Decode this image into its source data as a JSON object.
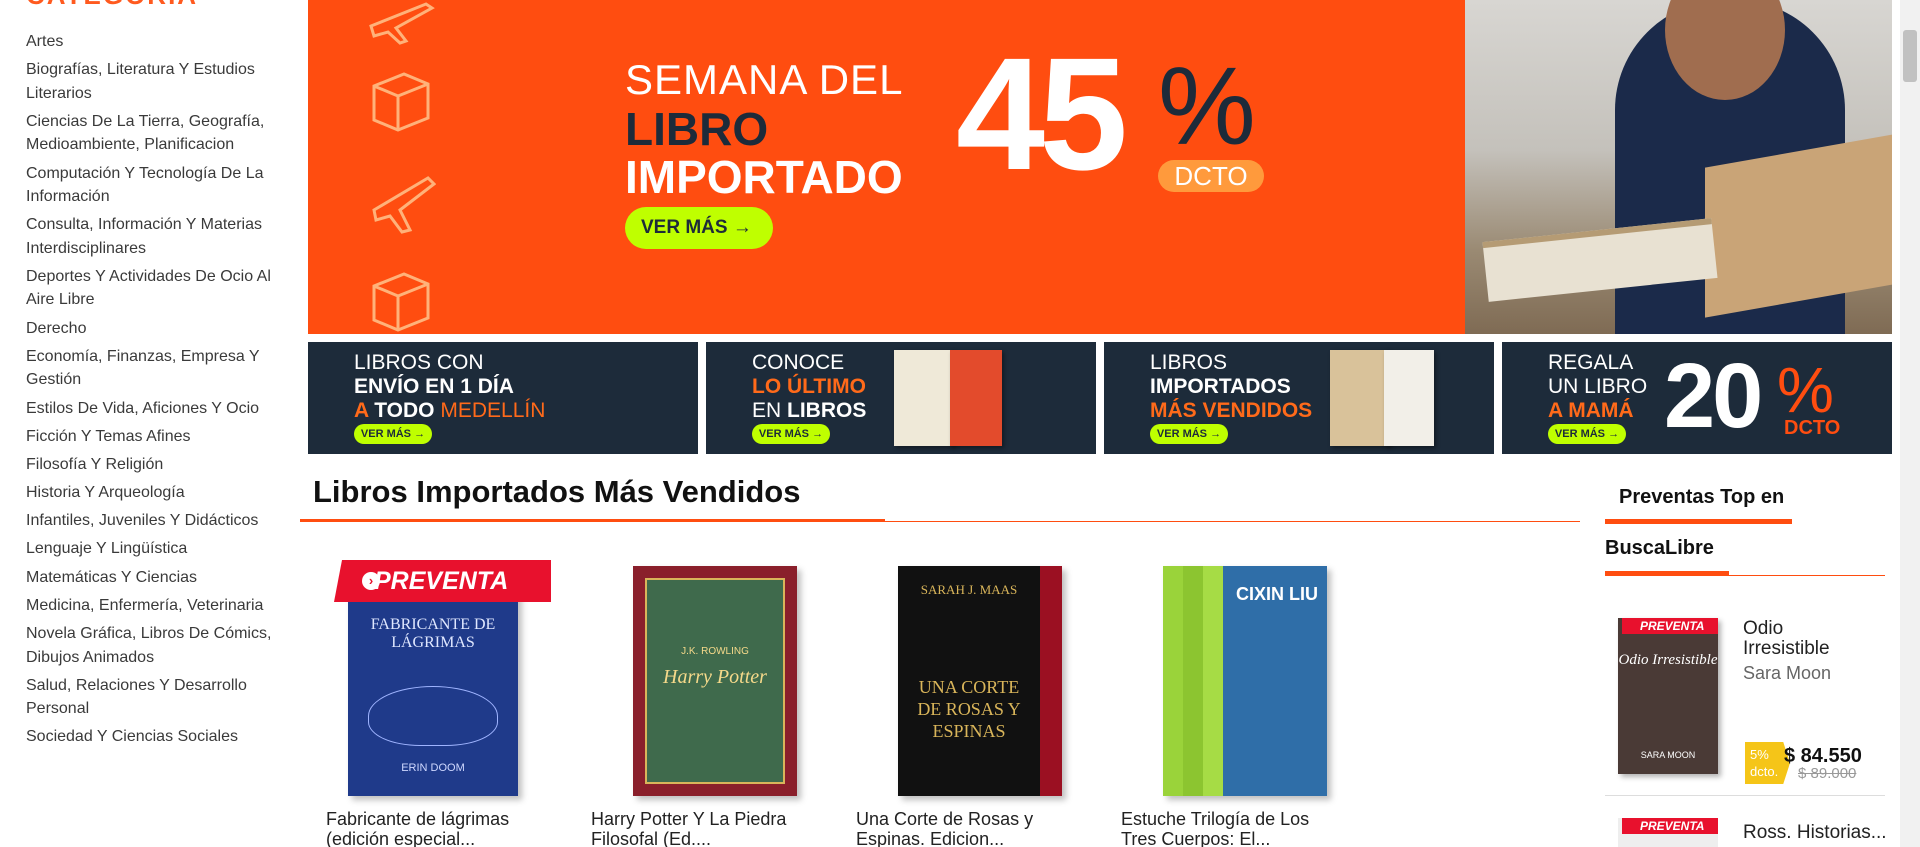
{
  "sidebar": {
    "title": "CATEGORÍA",
    "categories": [
      "Artes",
      "Biografías, Literatura Y Estudios Literarios",
      "Ciencias De La Tierra, Geografía, Medioambiente, Planificacion",
      "Computación Y Tecnología De La Información",
      "Consulta, Información Y Materias Interdisciplinares",
      "Deportes Y Actividades De Ocio Al Aire Libre",
      "Derecho",
      "Economía, Finanzas, Empresa Y Gestión",
      "Estilos De Vida, Aficiones Y Ocio",
      "Ficción Y Temas Afines",
      "Filosofía Y Religión",
      "Historia Y Arqueología",
      "Infantiles, Juveniles Y Didácticos",
      "Lenguaje Y Lingüística",
      "Matemáticas Y Ciencias",
      "Medicina, Enfermería, Veterinaria",
      "Novela Gráfica, Libros De Cómics, Dibujos Animados",
      "Salud, Relaciones Y Desarrollo Personal",
      "Sociedad Y Ciencias Sociales"
    ]
  },
  "hero": {
    "line1": "SEMANA DEL",
    "line2": "LIBRO",
    "line3": "IMPORTADO",
    "discount": "45",
    "percent": "%",
    "dcto": "DCTO",
    "button": "VER MÁS →"
  },
  "tiles": [
    {
      "l1": "LIBROS CON",
      "l2": "ENVÍO EN 1 DÍA",
      "l3a": "A ",
      "l3b": "TODO",
      "l3c": " MEDELLÍN",
      "button": "VER MÁS →"
    },
    {
      "l1": "CONOCE",
      "l2": "LO ÚLTIMO",
      "l3a": "EN ",
      "l3b": "LIBROS",
      "button": "VER MÁS →"
    },
    {
      "l1": "LIBROS",
      "l2": "IMPORTADOS",
      "l3": "MÁS VENDIDOS",
      "button": "VER MÁS →"
    },
    {
      "l1": "REGALA",
      "l2": "UN LIBRO",
      "l3": "A MAMÁ",
      "big": "20",
      "pct": "%",
      "dcto": "DCTO",
      "button": "VER MÁS →"
    }
  ],
  "section": {
    "title": "Libros Importados Más Vendidos",
    "badge": "PREVENTA",
    "products": [
      {
        "name": "Fabricante de lágrimas (edición especial...",
        "cover_color": "#1f3a8a",
        "cover_text": "FABRICANTE DE LÁGRIMAS",
        "cover_author": "ERIN DOOM"
      },
      {
        "name": "Harry Potter Y La Piedra Filosofal (Ed....",
        "cover_color": "#8a1f2b",
        "cover_text": "Harry Potter",
        "cover_author": "J.K. ROWLING"
      },
      {
        "name": "Una Corte de Rosas y Espinas. Edicion...",
        "cover_color": "#111111",
        "cover_text": "UNA CORTE DE ROSAS Y ESPINAS",
        "cover_author": "SARAH J. MAAS"
      },
      {
        "name": "Estuche Trilogía de Los Tres Cuerpos: El...",
        "cover_color": "#2f6ea8",
        "cover_text": "CIXIN LIU",
        "cover_author": "CIXIN LIU"
      }
    ]
  },
  "right_panel": {
    "title1": "Preventas Top en",
    "title2": "BuscaLibre",
    "badge": "PREVENTA",
    "item1": {
      "name": "Odio Irresistible",
      "author": "Sara Moon",
      "discount": "5% dcto.",
      "price": "$ 84.550",
      "old_price": "$ 89.000",
      "cover_text": "Odio Irresistible",
      "cover_author": "SARA MOON"
    },
    "item2": {
      "name": "Ross. Historias..."
    }
  }
}
